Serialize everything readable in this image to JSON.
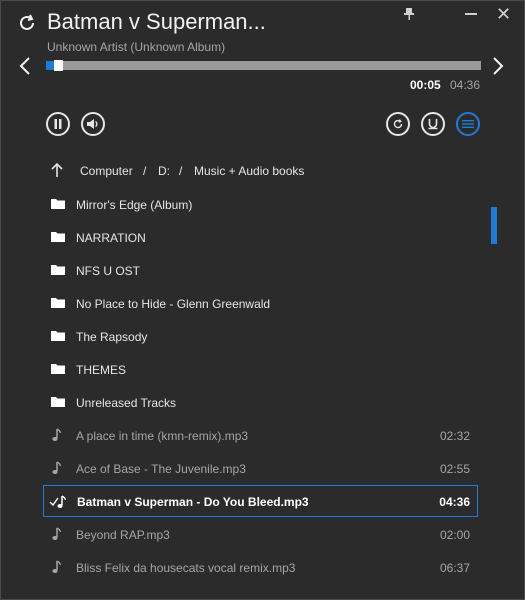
{
  "header": {
    "title": "Batman v Superman...",
    "subtitle": "Unknown Artist (Unknown Album)"
  },
  "playback": {
    "progress": 0.018,
    "current_time": "00:05",
    "total_time": "04:36"
  },
  "breadcrumb": {
    "items": [
      "Computer",
      "/",
      "D:",
      "/",
      "Music + Audio books"
    ]
  },
  "folders": [
    {
      "label": "Mirror's Edge (Album)"
    },
    {
      "label": "NARRATION"
    },
    {
      "label": "NFS U OST"
    },
    {
      "label": "No Place to Hide - Glenn Greenwald"
    },
    {
      "label": "The Rapsody"
    },
    {
      "label": "THEMES"
    },
    {
      "label": "Unreleased Tracks"
    }
  ],
  "tracks": [
    {
      "label": "A place in time (kmn-remix).mp3",
      "duration": "02:32",
      "current": false
    },
    {
      "label": "Ace of Base - The Juvenile.mp3",
      "duration": "02:55",
      "current": false
    },
    {
      "label": "Batman v Superman - Do You Bleed.mp3",
      "duration": "04:36",
      "current": true
    },
    {
      "label": "Beyond RAP.mp3",
      "duration": "02:00",
      "current": false
    },
    {
      "label": "Bliss Felix da housecats vocal remix.mp3",
      "duration": "06:37",
      "current": false
    }
  ],
  "colors": {
    "accent": "#1e7cd6",
    "background": "#2b2b2b"
  }
}
